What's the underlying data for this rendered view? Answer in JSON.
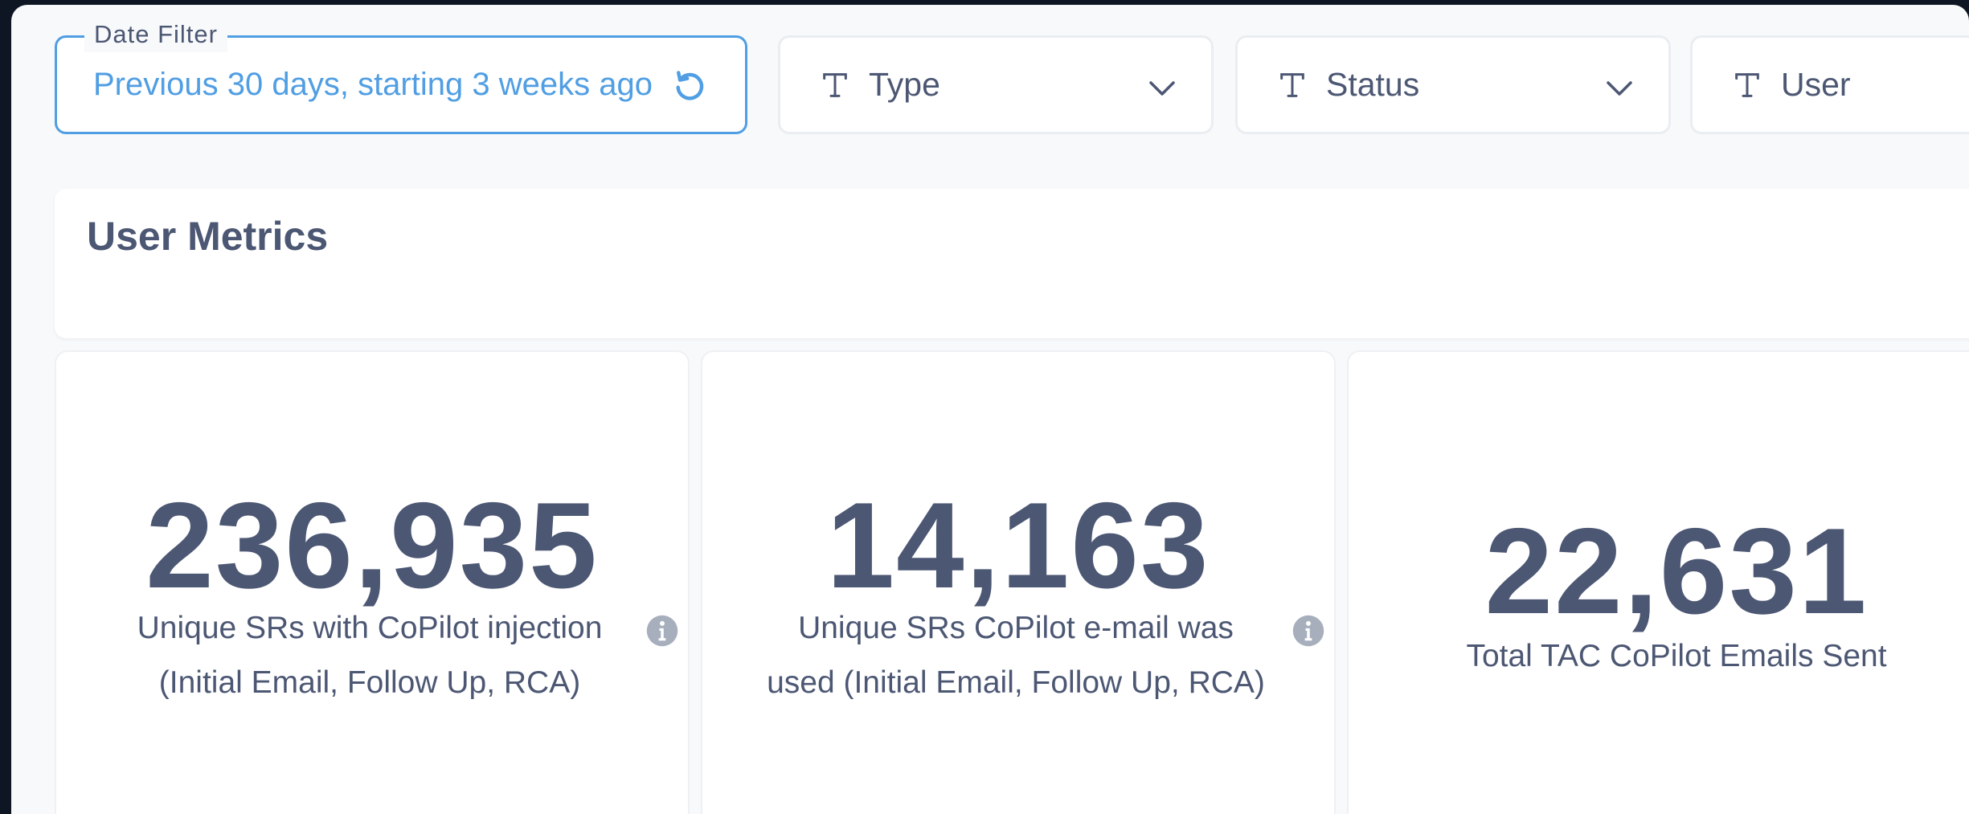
{
  "filters": {
    "date": {
      "legend": "Date Filter",
      "value": "Previous 30 days, starting 3 weeks ago"
    },
    "type": {
      "label": "Type"
    },
    "status": {
      "label": "Status"
    },
    "user": {
      "label": "User"
    }
  },
  "section": {
    "title": "User Metrics"
  },
  "metrics": [
    {
      "value": "236,935",
      "label": "Unique SRs with CoPilot injection (Initial Email, Follow Up, RCA)"
    },
    {
      "value": "14,163",
      "label": "Unique SRs CoPilot e-mail was used (Initial Email, Follow Up, RCA)"
    },
    {
      "value": "22,631",
      "label": "Total TAC CoPilot Emails Sent"
    }
  ],
  "colors": {
    "accent": "#509ee3",
    "text": "#4c5773",
    "background": "#f8f9fb"
  },
  "icons": [
    "reset-icon",
    "text-filter-icon",
    "chevron-down-icon",
    "info-icon"
  ]
}
